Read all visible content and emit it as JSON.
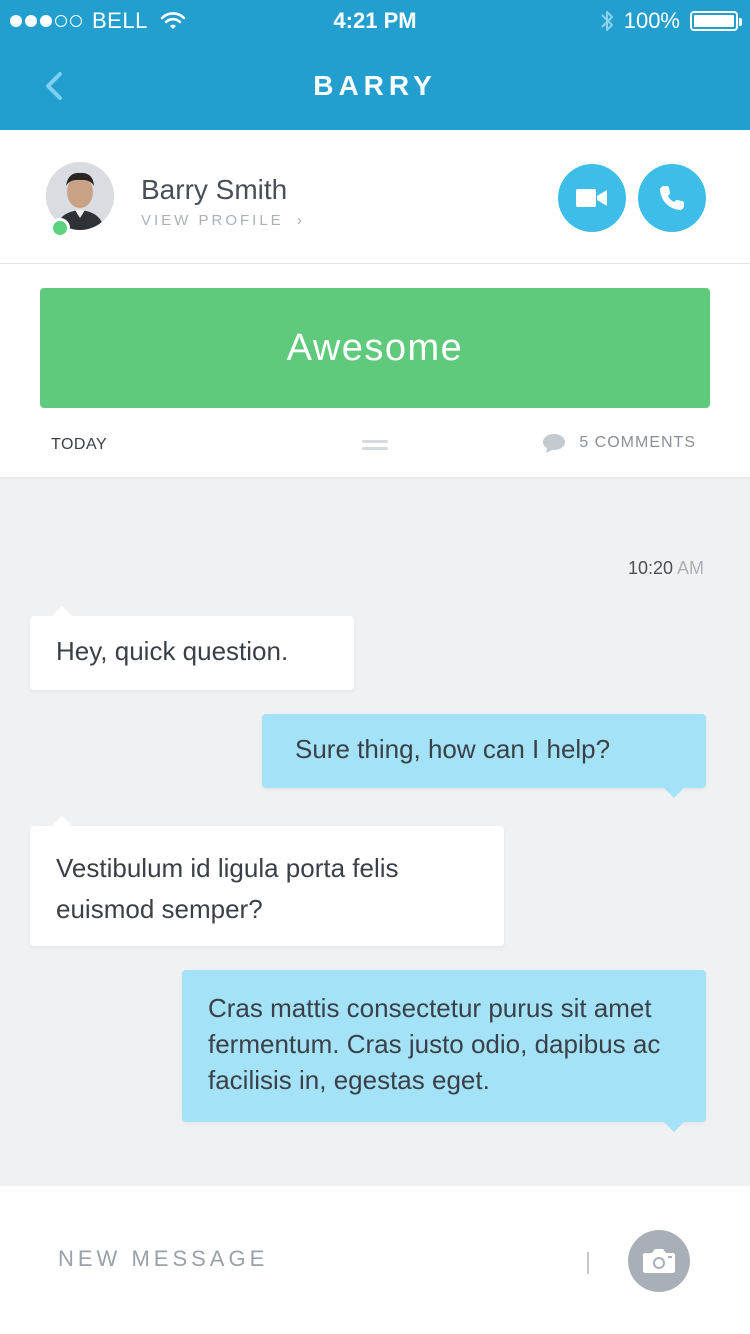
{
  "status_bar": {
    "carrier": "BELL",
    "time": "4:21 PM",
    "battery": "100%",
    "signal_bars_filled": 3,
    "signal_bars_total": 5
  },
  "nav": {
    "title": "BARRY",
    "back_icon": "chevron-left-icon"
  },
  "profile": {
    "name": "Barry Smith",
    "link_label": "VIEW PROFILE",
    "link_chevron": "›",
    "status": "online",
    "actions": [
      {
        "icon": "video-camera-icon"
      },
      {
        "icon": "phone-icon"
      }
    ]
  },
  "post": {
    "banner_text": "Awesome",
    "date_label": "TODAY",
    "comments_label": "5 COMMENTS"
  },
  "chat": {
    "timestamp": "10:20",
    "timestamp_ampm": "AM",
    "messages": [
      {
        "direction": "incoming",
        "text": "Hey, quick question."
      },
      {
        "direction": "outgoing",
        "text": "Sure thing, how can I help?"
      },
      {
        "direction": "incoming",
        "text": "Vestibulum id ligula porta felis euismod semper?"
      },
      {
        "direction": "outgoing",
        "text": "Cras mattis consectetur purus sit amet fermentum. Cras justo odio, dapibus ac facilisis in, egestas eget."
      }
    ]
  },
  "composer": {
    "placeholder": "NEW MESSAGE",
    "camera_icon": "camera-icon"
  },
  "colors": {
    "header": "#229fcf",
    "accent": "#3dbde8",
    "banner": "#5fc97c",
    "outgoing_bubble": "#a4e3f7",
    "online": "#5cd27e"
  }
}
